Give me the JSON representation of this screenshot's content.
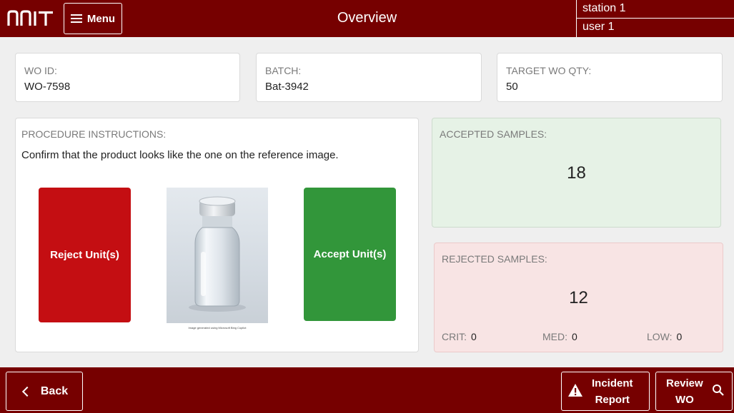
{
  "header": {
    "logo_text": "NNIT",
    "menu_label": "Menu",
    "title": "Overview",
    "station": "station 1",
    "user": "user 1"
  },
  "work_order": {
    "wo_id_label": "WO ID:",
    "wo_id": "WO-7598",
    "batch_label": "BATCH:",
    "batch": "Bat-3942",
    "target_qty_label": "TARGET WO QTY:",
    "target_qty": "50"
  },
  "procedure": {
    "label": "PROCEDURE INSTRUCTIONS:",
    "instruction": "Confirm that the product looks like the one on the reference image.",
    "reject_label": "Reject Unit(s)",
    "accept_label": "Accept Unit(s)",
    "image_caption": "Image generated using Microsoft Bing Copilot"
  },
  "accepted": {
    "label": "ACCEPTED SAMPLES:",
    "count": "18"
  },
  "rejected": {
    "label": "REJECTED SAMPLES:",
    "count": "12",
    "crit_label": "CRIT:",
    "crit": "0",
    "med_label": "MED:",
    "med": "0",
    "low_label": "LOW:",
    "low": "0"
  },
  "footer": {
    "back_label": "Back",
    "incident_line1": "Incident",
    "incident_line2": "Report",
    "review_line1": "Review",
    "review_line2": "WO"
  },
  "colors": {
    "brand": "#760000",
    "reject": "#c40e12",
    "accept": "#32963a",
    "accepted_bg": "#e6f2e6",
    "rejected_bg": "#f8e4e4"
  },
  "icons": {
    "menu": "hamburger-icon",
    "back": "chevron-left-icon",
    "incident": "warning-icon",
    "review": "search-icon"
  }
}
